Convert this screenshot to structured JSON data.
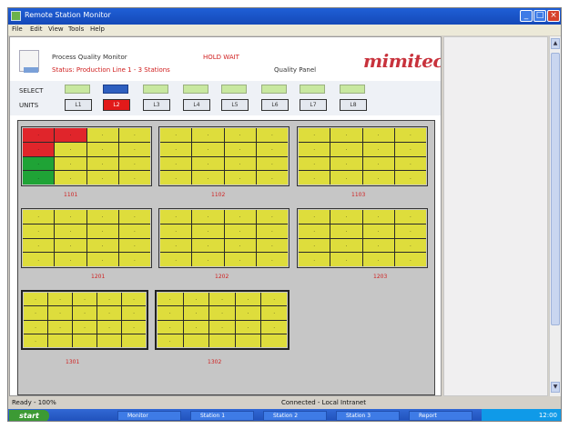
{
  "window": {
    "title": "Remote Station Monitor"
  },
  "menubar": [
    "File",
    "Edit",
    "View",
    "Tools",
    "Help"
  ],
  "header": {
    "line1": "Process Quality Monitor",
    "line2": "Status: Production Line 1 - 3 Stations",
    "center_label": "HOLD WAIT",
    "quality_label": "Quality Panel",
    "logo": "mimitec"
  },
  "controls": {
    "row1_label": "SELECT",
    "row2_label": "UNITS",
    "buttons": [
      "L1",
      "L2",
      "L3",
      "L4",
      "L5",
      "L6",
      "L7",
      "L8"
    ]
  },
  "groups": [
    {
      "label": "1101",
      "cells": [
        ".",
        ".",
        ".",
        ".",
        ".",
        ".",
        ".",
        ".",
        ".",
        ".",
        ".",
        ".",
        ".",
        ".",
        ".",
        "."
      ]
    },
    {
      "label": "1102",
      "cells": [
        ".",
        ".",
        ".",
        ".",
        ".",
        ".",
        ".",
        ".",
        ".",
        ".",
        ".",
        ".",
        ".",
        ".",
        ".",
        "."
      ]
    },
    {
      "label": "1103",
      "cells": [
        ".",
        ".",
        ".",
        ".",
        ".",
        ".",
        ".",
        ".",
        ".",
        ".",
        ".",
        ".",
        ".",
        ".",
        ".",
        "."
      ]
    },
    {
      "label": "1201",
      "cells": [
        ".",
        ".",
        ".",
        ".",
        ".",
        ".",
        ".",
        ".",
        ".",
        ".",
        ".",
        ".",
        ".",
        ".",
        ".",
        "."
      ]
    },
    {
      "label": "1202",
      "cells": [
        ".",
        ".",
        ".",
        ".",
        ".",
        ".",
        ".",
        ".",
        ".",
        ".",
        ".",
        ".",
        ".",
        ".",
        ".",
        "."
      ]
    },
    {
      "label": "1203",
      "cells": [
        ".",
        ".",
        ".",
        ".",
        ".",
        ".",
        ".",
        ".",
        ".",
        ".",
        ".",
        ".",
        ".",
        ".",
        ".",
        "."
      ]
    },
    {
      "label": "1301",
      "cells": [
        ".",
        ".",
        ".",
        ".",
        ".",
        ".",
        ".",
        ".",
        ".",
        ".",
        ".",
        ".",
        ".",
        ".",
        ".",
        "."
      ]
    },
    {
      "label": "1302",
      "cells": [
        ".",
        ".",
        ".",
        ".",
        ".",
        ".",
        ".",
        ".",
        ".",
        ".",
        ".",
        ".",
        ".",
        ".",
        ".",
        "."
      ]
    }
  ],
  "statusbar": {
    "left": "Ready - 100%",
    "right": "Connected - Local Intranet"
  },
  "taskbar": {
    "start": "start",
    "items": [
      "Monitor",
      "Station 1",
      "Station 2",
      "Station 3",
      "Report"
    ],
    "clock": "12:00"
  },
  "colors": {
    "cell_default": "#dedd3c",
    "cell_red": "#e0252b",
    "cell_green": "#1fa336",
    "accent": "#2e5fbf"
  }
}
